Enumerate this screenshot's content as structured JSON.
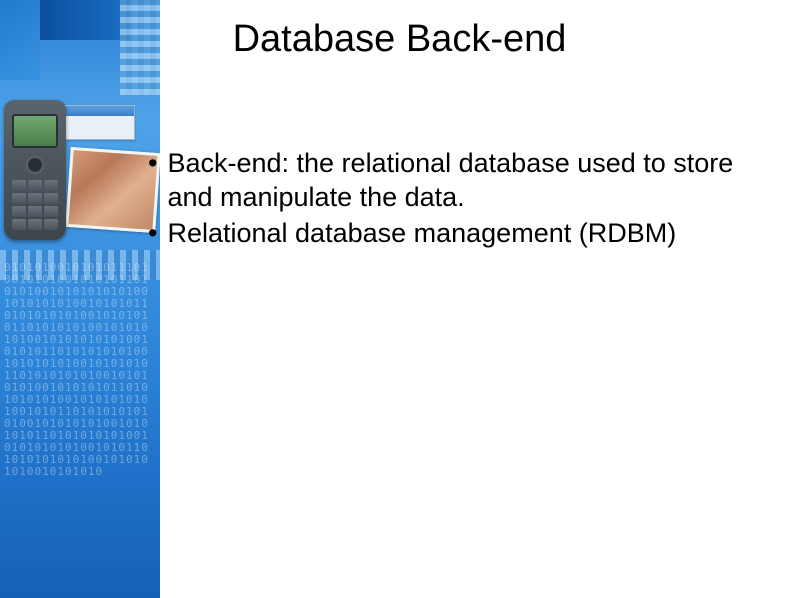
{
  "slide": {
    "title": "Database Back-end",
    "bullets": [
      "Back-end: the relational database used to store and manipulate the data.",
      "Relational database management (RDBM)"
    ]
  },
  "decoration": {
    "binary": "010101001010101110100101010010101011010101001010101010100101010101001010101101010101010010101010110101010100101010101001010101010100101010110101010101001010101010010101010110101010101001010101010010101010110101010101001010101010100101011010101010101001010101010010101010110101010101001010101010100101011010101010101001010101010010101010"
  }
}
